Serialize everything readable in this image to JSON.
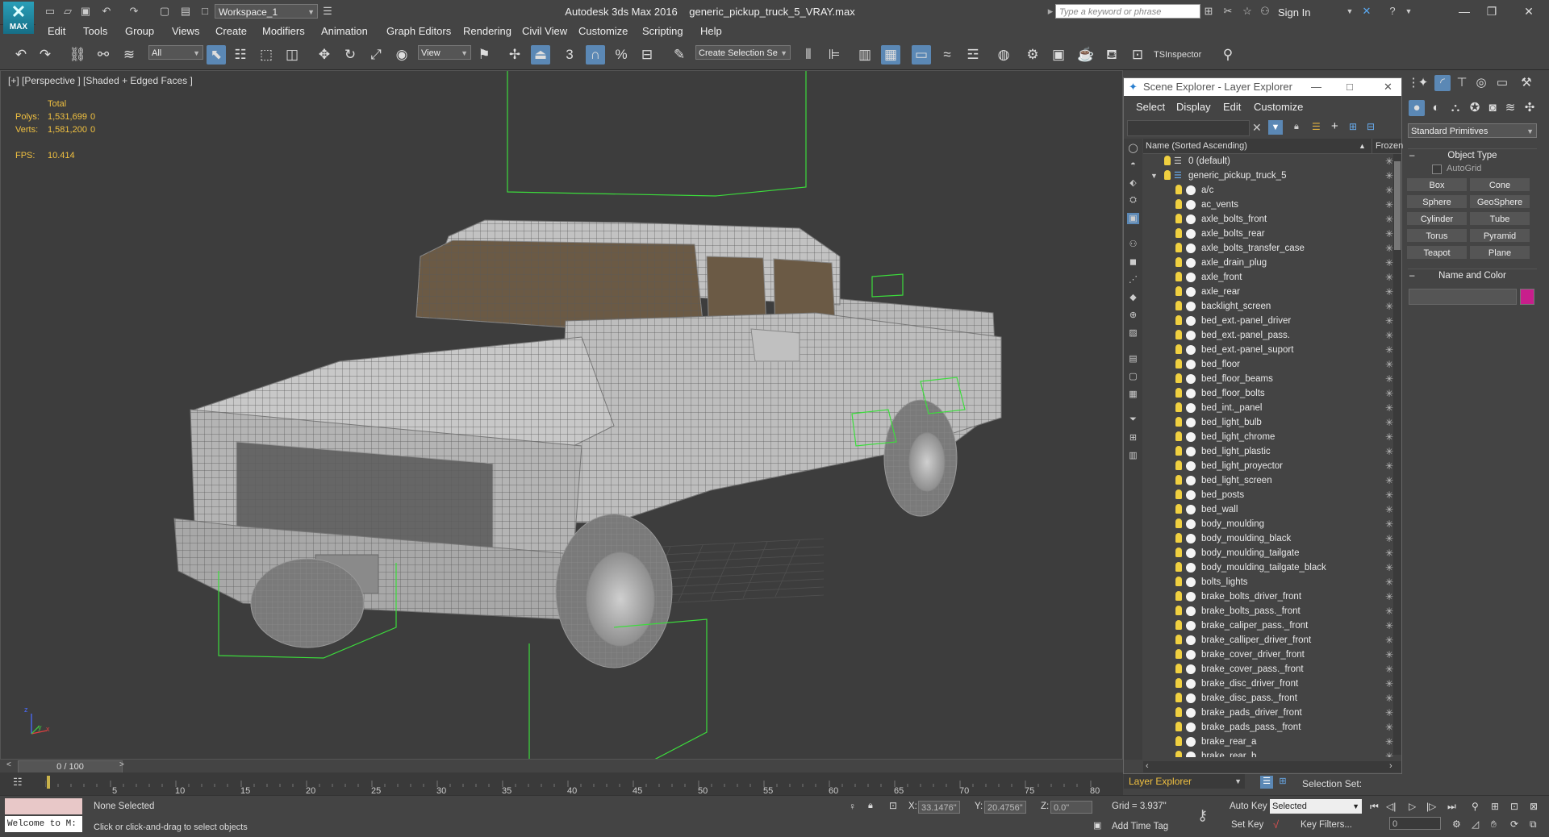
{
  "app": {
    "title": "Autodesk 3ds Max 2016",
    "file": "generic_pickup_truck_5_VRAY.max",
    "logo_label": "MAX",
    "workspace": "Workspace_1",
    "search_placeholder": "Type a keyword or phrase",
    "sign_in": "Sign In"
  },
  "menu": [
    "Edit",
    "Tools",
    "Group",
    "Views",
    "Create",
    "Modifiers",
    "Animation",
    "Graph Editors",
    "Rendering",
    "Civil View",
    "Customize",
    "Scripting",
    "Help"
  ],
  "toolbar": {
    "filter": "All",
    "ref_coord": "View",
    "selection_set_placeholder": "Create Selection Se",
    "snap_label": "3",
    "tsinspector": "TSInspector"
  },
  "viewport": {
    "label": "[+] [Perspective ] [Shaded + Edged Faces ]",
    "stats": {
      "total_label": "Total",
      "polys_label": "Polys:",
      "polys_value": "1,531,699",
      "polys_sel": "0",
      "verts_label": "Verts:",
      "verts_value": "1,581,200",
      "verts_sel": "0",
      "fps_label": "FPS:",
      "fps_value": "10.414"
    },
    "axis_z": "z",
    "axis_y": "y",
    "axis_x": "x"
  },
  "scene_explorer": {
    "title": "Scene Explorer - Layer Explorer",
    "menu": [
      "Select",
      "Display",
      "Edit",
      "Customize"
    ],
    "col_name": "Name (Sorted Ascending)",
    "col_frozen": "Frozen",
    "layers": [
      {
        "name": "0 (default)"
      },
      {
        "name": "generic_pickup_truck_5"
      }
    ],
    "objects": [
      "a/c",
      "ac_vents",
      "axle_bolts_front",
      "axle_bolts_rear",
      "axle_bolts_transfer_case",
      "axle_drain_plug",
      "axle_front",
      "axle_rear",
      "backlight_screen",
      "bed_ext.-panel_driver",
      "bed_ext.-panel_pass.",
      "bed_ext.-panel_suport",
      "bed_floor",
      "bed_floor_beams",
      "bed_floor_bolts",
      "bed_int._panel",
      "bed_light_bulb",
      "bed_light_chrome",
      "bed_light_plastic",
      "bed_light_proyector",
      "bed_light_screen",
      "bed_posts",
      "bed_wall",
      "body_moulding",
      "body_moulding_black",
      "body_moulding_tailgate",
      "body_moulding_tailgate_black",
      "bolts_lights",
      "brake_bolts_driver_front",
      "brake_bolts_pass._front",
      "brake_caliper_pass._front",
      "brake_calliper_driver_front",
      "brake_cover_driver_front",
      "brake_cover_pass._front",
      "brake_disc_driver_front",
      "brake_disc_pass._front",
      "brake_pads_driver_front",
      "brake_pads_pass._front",
      "brake_rear_a",
      "brake_rear_b"
    ],
    "footer": "Layer Explorer",
    "selection_set": "Selection Set:"
  },
  "command_panel": {
    "category": "Standard Primitives",
    "object_type": "Object Type",
    "autogrid": "AutoGrid",
    "buttons": [
      "Box",
      "Cone",
      "Sphere",
      "GeoSphere",
      "Cylinder",
      "Tube",
      "Torus",
      "Pyramid",
      "Teapot",
      "Plane"
    ],
    "name_color": "Name and Color",
    "swatch_color": "#c81e8c"
  },
  "timeline": {
    "frame": "0 / 100",
    "ticks": [
      "5",
      "10",
      "15",
      "20",
      "25",
      "30",
      "35",
      "40",
      "45",
      "50",
      "55",
      "60",
      "65",
      "70",
      "75",
      "80"
    ]
  },
  "status": {
    "maxscript": "Welcome to M:",
    "selection": "None Selected",
    "prompt": "Click or click-and-drag to select objects",
    "x_label": "X:",
    "x_value": "33.1476\"",
    "y_label": "Y:",
    "y_value": "20.4756\"",
    "z_label": "Z:",
    "z_value": "0.0\"",
    "grid": "Grid = 3.937\"",
    "add_time_tag": "Add Time Tag",
    "auto_key": "Auto Key",
    "set_key": "Set Key",
    "key_mode": "Selected",
    "key_filters": "Key Filters...",
    "frame_value": "0"
  }
}
